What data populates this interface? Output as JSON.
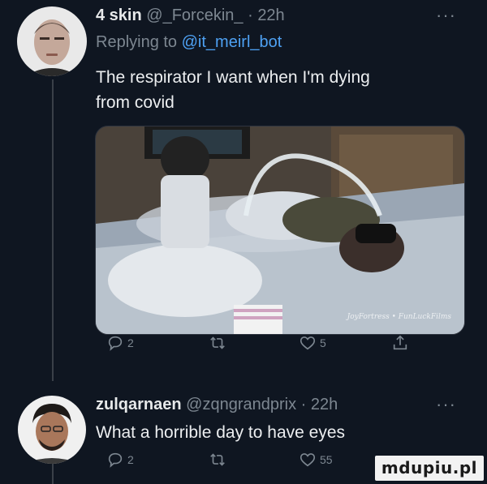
{
  "tweet1": {
    "display_name": "4 skin",
    "handle": "@_Forcekin_",
    "separator": "·",
    "time": "22h",
    "more": "···",
    "reply_prefix": "Replying to",
    "reply_to": "@it_meirl_bot",
    "text_line1": "The respirator I want when I'm dying",
    "text_line2": "from covid",
    "media_watermark": "JoyFortress • FunLuckFilms",
    "actions": {
      "reply_icon": "reply-icon",
      "reply_count": "2",
      "retweet_icon": "retweet-icon",
      "like_icon": "heart-icon",
      "like_count": "5",
      "share_icon": "share-icon"
    }
  },
  "tweet2": {
    "display_name": "zulqarnaen",
    "handle": "@zqngrandprix",
    "separator": "·",
    "time": "22h",
    "more": "···",
    "text": "What a horrible day to have eyes",
    "actions": {
      "reply_icon": "reply-icon",
      "reply_count": "2",
      "retweet_icon": "retweet-icon",
      "like_icon": "heart-icon",
      "like_count": "55"
    }
  },
  "site_watermark": "mdupiu.pl",
  "colors": {
    "background": "#0f1621",
    "text": "#e7e9ea",
    "muted": "#7d8791",
    "link": "#4ea1f3"
  }
}
